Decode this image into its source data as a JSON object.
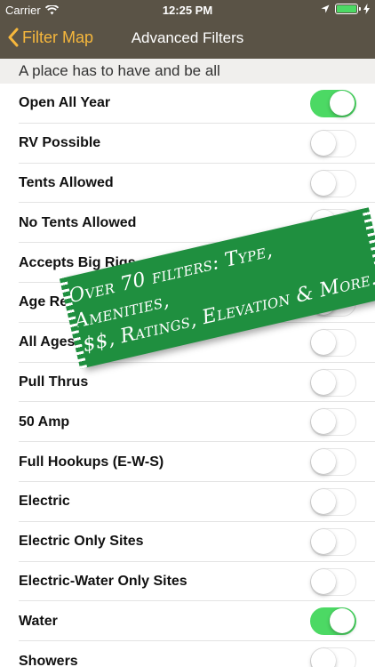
{
  "status_bar": {
    "carrier": "Carrier",
    "time": "12:25 PM",
    "battery_color": "#4cd964"
  },
  "nav": {
    "back_label": "Filter Map",
    "title": "Advanced Filters"
  },
  "section_header": "A place has to have and be all",
  "filters": [
    {
      "label": "Open All Year",
      "on": true
    },
    {
      "label": "RV Possible",
      "on": false
    },
    {
      "label": "Tents Allowed",
      "on": false
    },
    {
      "label": "No Tents Allowed",
      "on": false
    },
    {
      "label": "Accepts Big Rigs",
      "on": false
    },
    {
      "label": "Age Re",
      "on": false
    },
    {
      "label": "All Ages",
      "on": false
    },
    {
      "label": "Pull Thrus",
      "on": false
    },
    {
      "label": "50 Amp",
      "on": false
    },
    {
      "label": "Full Hookups (E-W-S)",
      "on": false
    },
    {
      "label": "Electric",
      "on": false
    },
    {
      "label": "Electric Only Sites",
      "on": false
    },
    {
      "label": "Electric-Water Only Sites",
      "on": false
    },
    {
      "label": "Water",
      "on": true
    },
    {
      "label": "Showers",
      "on": false
    }
  ],
  "banner": {
    "line1": "Over 70 filters: Type, Amenities,",
    "line2": "$$, Ratings, Elevation & More."
  },
  "colors": {
    "bar_bg": "#5a5346",
    "accent": "#f6b73c",
    "toggle_on": "#4cd964",
    "banner_green": "#1f8f3f"
  }
}
